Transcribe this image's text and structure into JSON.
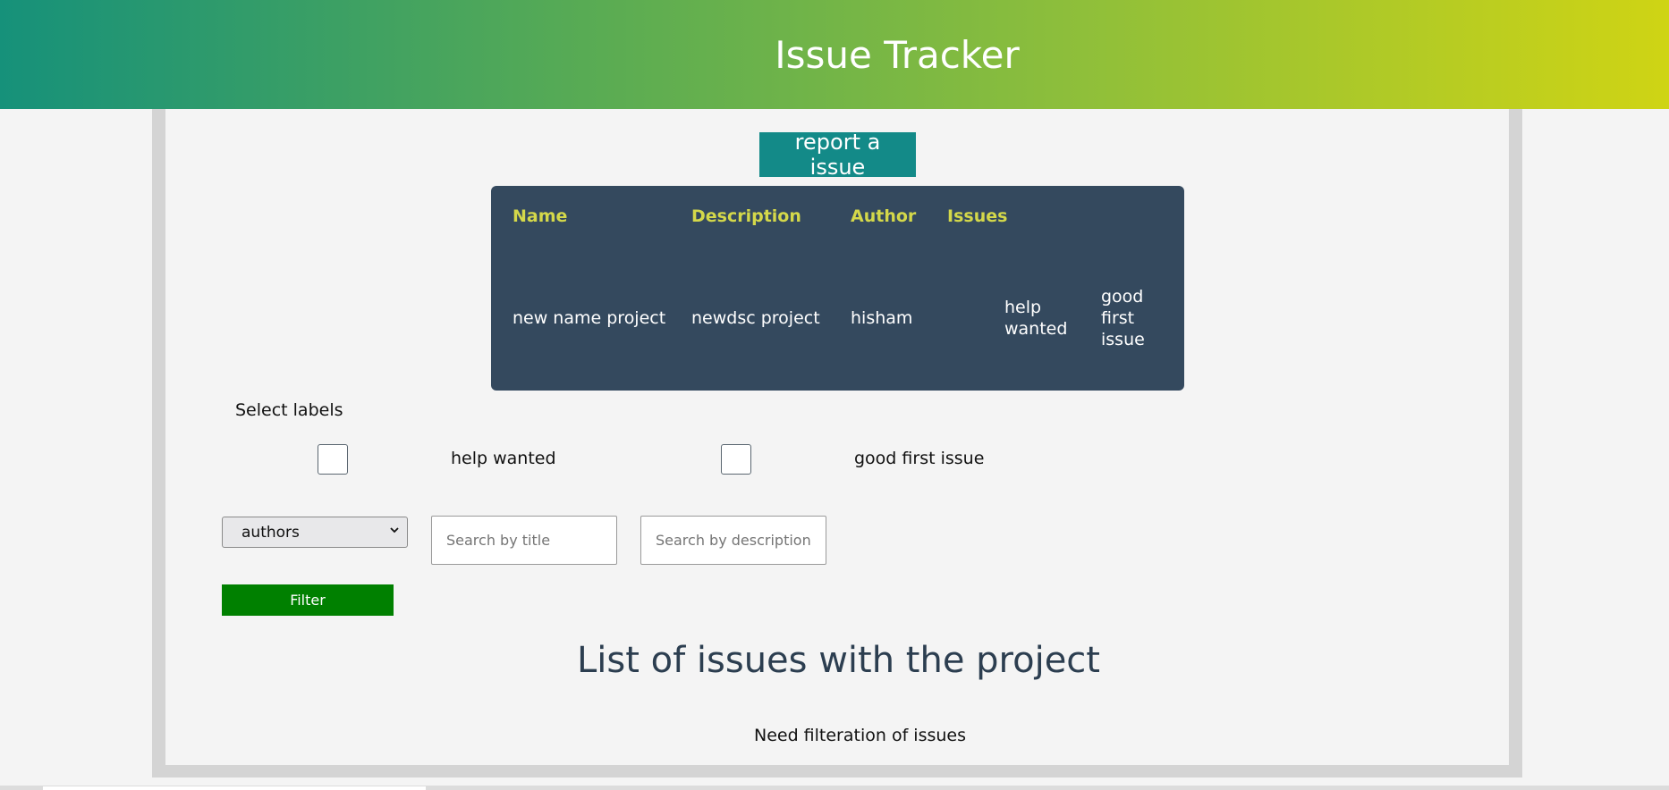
{
  "header": {
    "title": "Issue Tracker"
  },
  "actions": {
    "report_label": "report a issue"
  },
  "project_table": {
    "columns": [
      "Name",
      "Description",
      "Author",
      "Issues"
    ],
    "row": {
      "name": "new name project",
      "description": "newdsc project",
      "author": "hisham",
      "issues": [
        "help wanted",
        "good first issue"
      ]
    }
  },
  "filters": {
    "select_labels_heading": "Select labels",
    "labels": [
      {
        "label": "help wanted",
        "checked": false
      },
      {
        "label": "good first issue",
        "checked": false
      }
    ],
    "author_select": {
      "selected": "authors"
    },
    "title_search": {
      "placeholder": "Search by title",
      "value": ""
    },
    "description_search": {
      "placeholder": "Search by description",
      "value": ""
    },
    "filter_button_label": "Filter"
  },
  "issues_section": {
    "title": "List of issues with the project",
    "message": "Need filteration of issues"
  },
  "colors": {
    "header_gradient_start": "#16917a",
    "header_gradient_end": "#cfd414",
    "report_button": "#138a88",
    "card_background": "#34495e",
    "card_header_text": "#d4d84a",
    "filter_button": "#008000",
    "list_title_text": "#2c3e50"
  }
}
